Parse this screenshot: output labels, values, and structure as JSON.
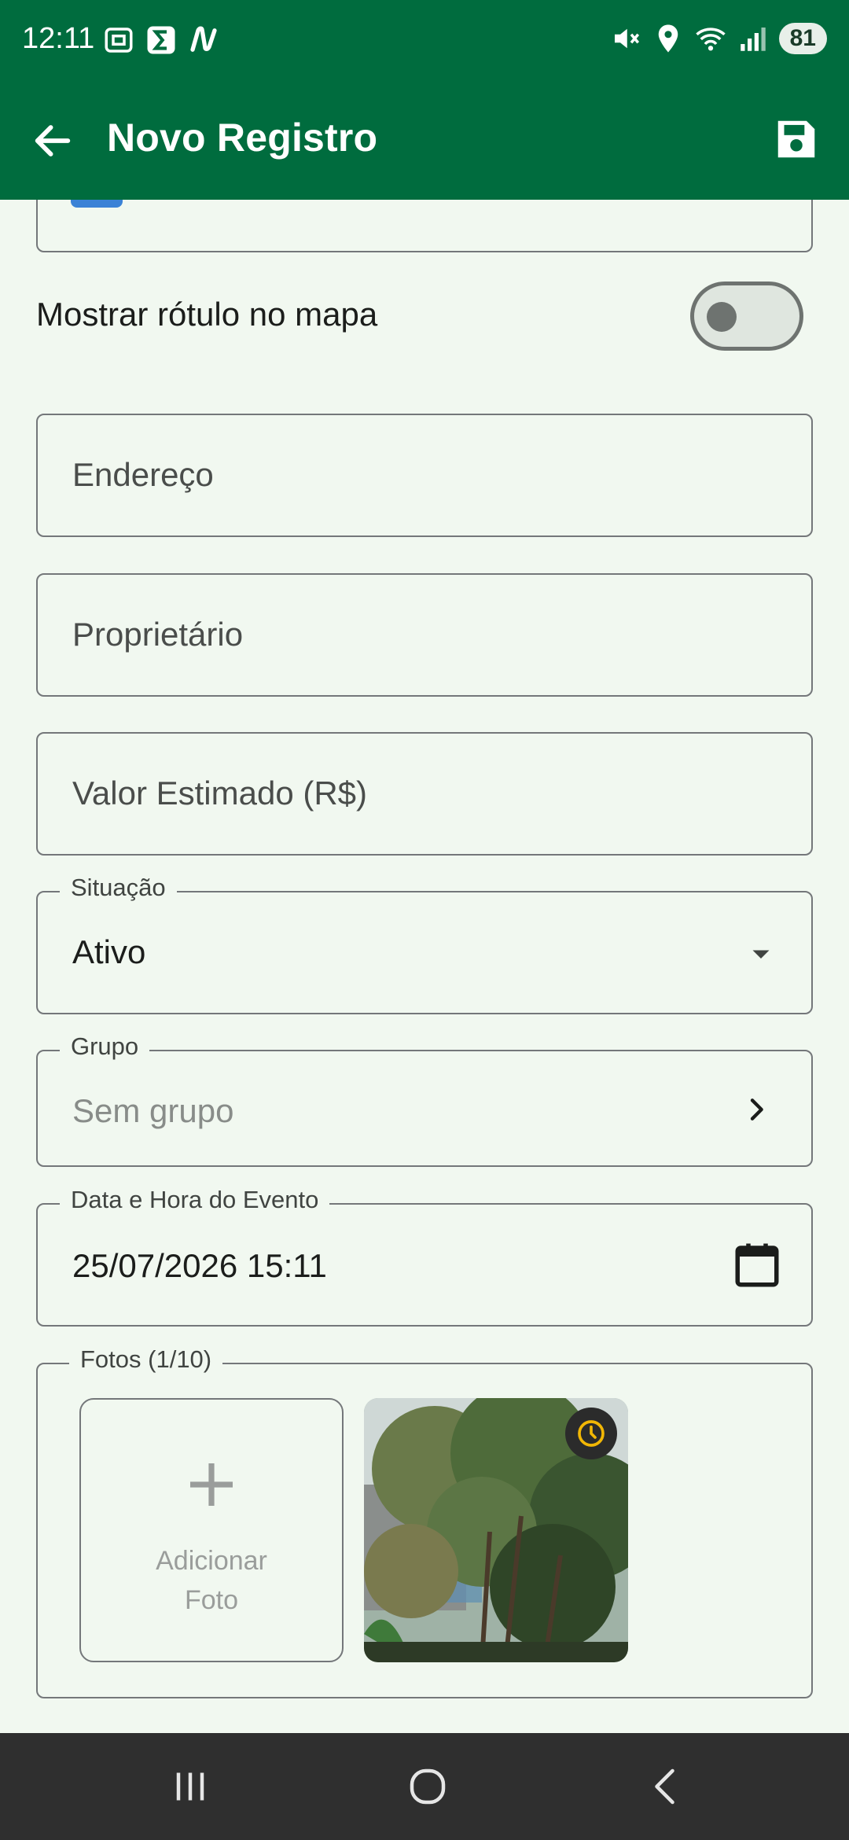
{
  "status_bar": {
    "time": "12:11",
    "battery": "81",
    "icons": [
      "screenshot-icon",
      "sigma-app-icon",
      "n-app-icon",
      "mute-icon",
      "location-icon",
      "wifi-icon",
      "signal-icon"
    ]
  },
  "app_bar": {
    "title": "Novo Registro",
    "back_icon": "arrow-left-icon",
    "save_icon": "save-icon"
  },
  "form": {
    "show_label_toggle": {
      "label": "Mostrar rótulo no mapa",
      "on": false
    },
    "address": {
      "placeholder": "Endereço"
    },
    "owner": {
      "placeholder": "Proprietário"
    },
    "estimated_value": {
      "placeholder": "Valor Estimado (R$)"
    },
    "status": {
      "label": "Situação",
      "value": "Ativo"
    },
    "group": {
      "label": "Grupo",
      "value": "Sem grupo"
    },
    "event_datetime": {
      "label": "Data e Hora do Evento",
      "value": "25/07/2026 15:11"
    },
    "photos": {
      "label": "Fotos (1/10)",
      "add_label_line1": "Adicionar",
      "add_label_line2": "Foto"
    }
  },
  "colors": {
    "primary": "#006c3e",
    "background": "#f1f8f0",
    "outline": "#74777a",
    "nav_bar": "#2f2f2f",
    "clock_badge": "#f2b705"
  }
}
